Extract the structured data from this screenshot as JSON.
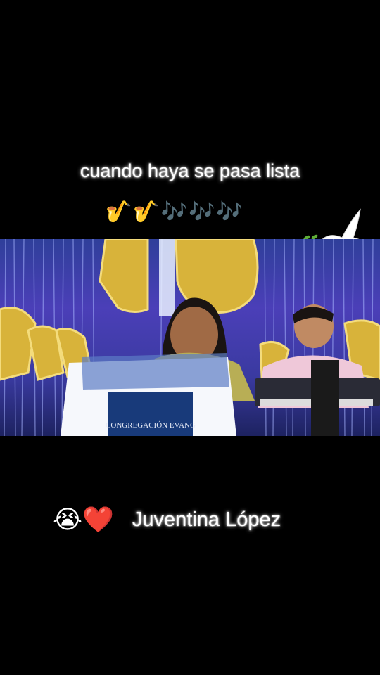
{
  "caption_top": "cuando haya se pasa lista",
  "emoji_row": "🎷🎷🎶🎶🎶",
  "bottom": {
    "emoji": "😭❤️",
    "name": "Juventina López"
  },
  "video": {
    "podium_text": "CONGREGACIÓN EVANG"
  },
  "colors": {
    "background": "#000000",
    "tinsel": "#4a46c4",
    "balloon_gold": "#d8b33a",
    "caption_glow": "#ffffff"
  },
  "icons": [
    "dove-icon",
    "olive-branch-icon",
    "saxophone-icon",
    "music-notes-icon"
  ]
}
